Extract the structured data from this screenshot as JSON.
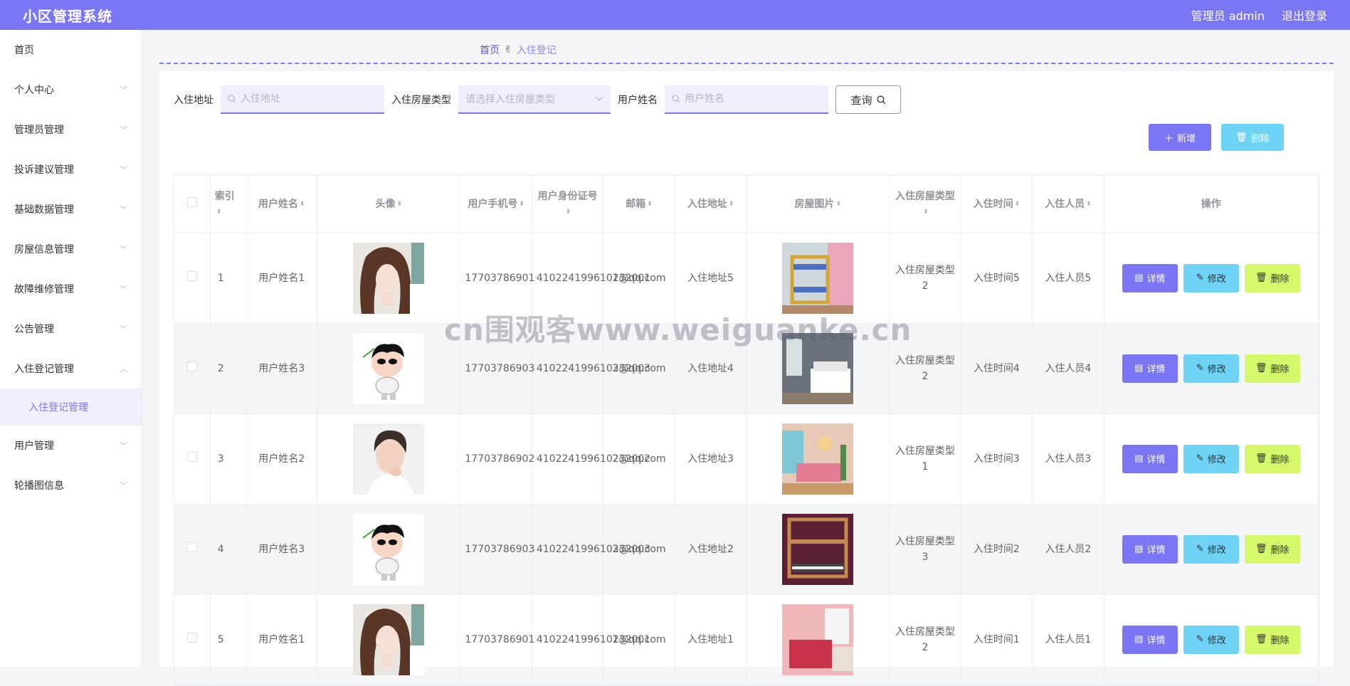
{
  "app": {
    "title": "小区管理系统",
    "user_label": "管理员 admin",
    "logout_label": "退出登录",
    "accent": "#7b76f4"
  },
  "sidebar": {
    "items": [
      {
        "label": "首页",
        "has_children": false
      },
      {
        "label": "个人中心",
        "has_children": true
      },
      {
        "label": "管理员管理",
        "has_children": true
      },
      {
        "label": "投诉建议管理",
        "has_children": true
      },
      {
        "label": "基础数据管理",
        "has_children": true
      },
      {
        "label": "房屋信息管理",
        "has_children": true
      },
      {
        "label": "故障维修管理",
        "has_children": true
      },
      {
        "label": "公告管理",
        "has_children": true
      },
      {
        "label": "入住登记管理",
        "has_children": true,
        "expanded": true,
        "children": [
          "入住登记管理"
        ]
      },
      {
        "label": "用户管理",
        "has_children": true
      },
      {
        "label": "轮播图信息",
        "has_children": true
      }
    ]
  },
  "breadcrumb": {
    "home": "首页",
    "current": "入住登记"
  },
  "search": {
    "address_label": "入住地址",
    "address_placeholder": "入住地址",
    "type_label": "入住房屋类型",
    "type_placeholder": "请选择入住房屋类型",
    "name_label": "用户姓名",
    "name_placeholder": "用户姓名",
    "query_label": "查询"
  },
  "toolbar": {
    "add_label": "新增",
    "delete_label": "删除"
  },
  "table": {
    "columns": [
      "索引",
      "用户姓名",
      "头像",
      "用户手机号",
      "用户身份证号",
      "邮箱",
      "入住地址",
      "房屋图片",
      "入住房屋类型",
      "入住时间",
      "入住人员",
      "操作"
    ],
    "row_actions": {
      "detail": "详情",
      "edit": "修改",
      "delete": "删除"
    },
    "rows": [
      {
        "index": "1",
        "name": "用户姓名1",
        "avatar": "woman-portrait",
        "phone": "17703786901",
        "idcard": "410224199610232001",
        "email": "1@qq.com",
        "address": "入住地址5",
        "house_image": "bunk-bed-room",
        "house_type": "入住房屋类型2",
        "time": "入住时间5",
        "people": "入住人员5"
      },
      {
        "index": "2",
        "name": "用户姓名3",
        "avatar": "cartoon-boy",
        "phone": "17703786903",
        "idcard": "410224199610232003",
        "email": "3@qq.com",
        "address": "入住地址4",
        "house_image": "grey-bedroom",
        "house_type": "入住房屋类型2",
        "time": "入住时间4",
        "people": "入住人员4"
      },
      {
        "index": "3",
        "name": "用户姓名2",
        "avatar": "man-portrait",
        "phone": "17703786902",
        "idcard": "410224199610232002",
        "email": "2@qq.com",
        "address": "入住地址3",
        "house_image": "pink-bedroom",
        "house_type": "入住房屋类型1",
        "time": "入住时间3",
        "people": "入住人员3"
      },
      {
        "index": "4",
        "name": "用户姓名3",
        "avatar": "cartoon-boy",
        "phone": "17703786903",
        "idcard": "410224199610232003",
        "email": "3@qq.com",
        "address": "入住地址2",
        "house_image": "wooden-bunk-room",
        "house_type": "入住房屋类型3",
        "time": "入住时间2",
        "people": "入住人员2"
      },
      {
        "index": "5",
        "name": "用户姓名1",
        "avatar": "woman-portrait",
        "phone": "17703786901",
        "idcard": "410224199610232001",
        "email": "1@qq.com",
        "address": "入住地址1",
        "house_image": "red-bedroom",
        "house_type": "入住房屋类型2",
        "time": "入住时间1",
        "people": "入住人员1"
      }
    ]
  },
  "watermark": "cn围观客www.weiguanke.cn"
}
